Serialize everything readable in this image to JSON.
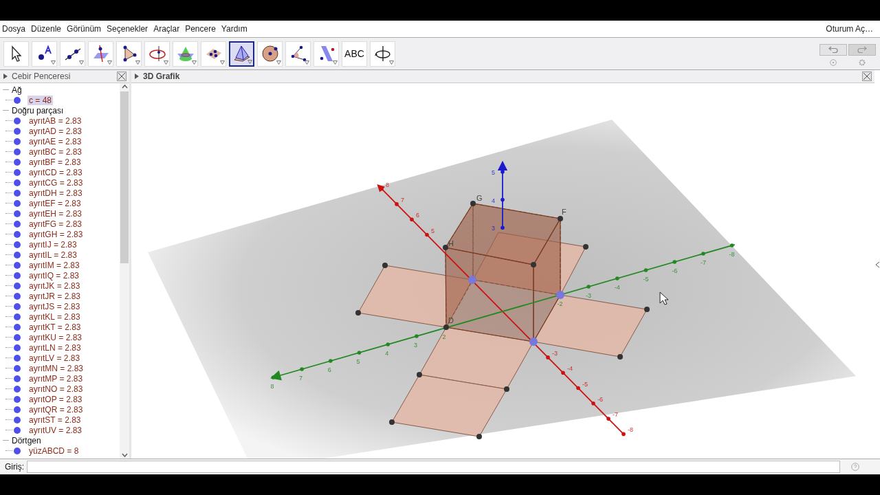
{
  "menu": [
    {
      "label": "Dosya"
    },
    {
      "label": "Düzenle"
    },
    {
      "label": "Görünüm"
    },
    {
      "label": "Seçenekler"
    },
    {
      "label": "Araçlar"
    },
    {
      "label": "Pencere"
    },
    {
      "label": "Yardım"
    }
  ],
  "account": "Oturum Aç…",
  "toolbar": [
    {
      "kind": "move",
      "selected": false
    },
    {
      "kind": "point",
      "selected": false
    },
    {
      "kind": "line",
      "selected": false
    },
    {
      "kind": "perpendicular",
      "selected": false
    },
    {
      "kind": "polygon",
      "selected": false
    },
    {
      "kind": "circle",
      "selected": false
    },
    {
      "kind": "intersect",
      "selected": false
    },
    {
      "kind": "plane",
      "selected": false
    },
    {
      "kind": "pyramid",
      "selected": true
    },
    {
      "kind": "sphere",
      "selected": false
    },
    {
      "kind": "angle",
      "selected": false
    },
    {
      "kind": "reflect",
      "selected": false
    },
    {
      "kind": "text",
      "label": "ABC",
      "selected": false
    },
    {
      "kind": "rotate",
      "selected": false
    }
  ],
  "algebra_view": {
    "title": "Cebir Penceresi",
    "groups": [
      {
        "label": "Ağ",
        "expanded": true,
        "children": [
          {
            "label": "c = 48",
            "selected": true
          }
        ]
      },
      {
        "label": "Doğru parçası",
        "expanded": true,
        "children": [
          {
            "label": "ayrıtAB = 2.83",
            "selected": false
          },
          {
            "label": "ayrıtAD = 2.83",
            "selected": false
          },
          {
            "label": "ayrıtAE = 2.83",
            "selected": false
          },
          {
            "label": "ayrıtBC = 2.83",
            "selected": false
          },
          {
            "label": "ayrıtBF = 2.83",
            "selected": false
          },
          {
            "label": "ayrıtCD = 2.83",
            "selected": false
          },
          {
            "label": "ayrıtCG = 2.83",
            "selected": false
          },
          {
            "label": "ayrıtDH = 2.83",
            "selected": false
          },
          {
            "label": "ayrıtEF = 2.83",
            "selected": false
          },
          {
            "label": "ayrıtEH = 2.83",
            "selected": false
          },
          {
            "label": "ayrıtFG = 2.83",
            "selected": false
          },
          {
            "label": "ayrıtGH = 2.83",
            "selected": false
          },
          {
            "label": "ayrıtIJ = 2.83",
            "selected": false
          },
          {
            "label": "ayrıtIL = 2.83",
            "selected": false
          },
          {
            "label": "ayrıtIM = 2.83",
            "selected": false
          },
          {
            "label": "ayrıtIQ = 2.83",
            "selected": false
          },
          {
            "label": "ayrıtJK = 2.83",
            "selected": false
          },
          {
            "label": "ayrıtJR = 2.83",
            "selected": false
          },
          {
            "label": "ayrıtJS = 2.83",
            "selected": false
          },
          {
            "label": "ayrıtKL = 2.83",
            "selected": false
          },
          {
            "label": "ayrıtKT = 2.83",
            "selected": false
          },
          {
            "label": "ayrıtKU = 2.83",
            "selected": false
          },
          {
            "label": "ayrıtLN = 2.83",
            "selected": false
          },
          {
            "label": "ayrıtLV = 2.83",
            "selected": false
          },
          {
            "label": "ayrıtMN = 2.83",
            "selected": false
          },
          {
            "label": "ayrıtMP = 2.83",
            "selected": false
          },
          {
            "label": "ayrıtNO = 2.83",
            "selected": false
          },
          {
            "label": "ayrıtOP = 2.83",
            "selected": false
          },
          {
            "label": "ayrıtQR = 2.83",
            "selected": false
          },
          {
            "label": "ayrıtST = 2.83",
            "selected": false
          },
          {
            "label": "ayrıtUV = 2.83",
            "selected": false
          }
        ]
      },
      {
        "label": "Dörtgen",
        "expanded": true,
        "children": [
          {
            "label": "yüzABCD = 8",
            "selected": false
          }
        ]
      }
    ]
  },
  "graphics_view": {
    "title": "3D Grafik",
    "axes": [
      {
        "kind": "x",
        "color": "#cc1111",
        "labels": [
          "8",
          "7",
          "6",
          "5",
          "-3",
          "-4",
          "-5",
          "-6",
          "-7",
          "-8"
        ]
      },
      {
        "kind": "y",
        "color": "#228822",
        "labels": [
          "8",
          "7",
          "6",
          "5",
          "4",
          "3",
          "2",
          "-2",
          "-3",
          "-4",
          "-5",
          "-6",
          "-7",
          "-8"
        ]
      },
      {
        "kind": "z",
        "color": "#1a1acc",
        "labels": [
          "5",
          "4",
          "3"
        ]
      }
    ],
    "vertex_labels": [
      "G",
      "F",
      "H",
      "D"
    ]
  },
  "input_bar": {
    "label": "Giriş:"
  }
}
